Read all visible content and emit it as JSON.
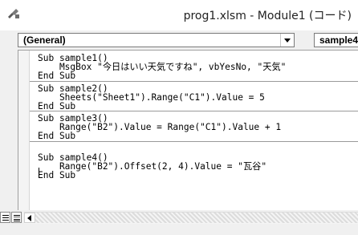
{
  "window": {
    "title": "prog1.xlsm - Module1 (コード)",
    "app_icon": "vba-editor-icon"
  },
  "combos": {
    "object": "(General)",
    "procedure": "sample4"
  },
  "code": {
    "blocks": [
      {
        "lines": [
          [
            "Sub sample1()",
            "sub"
          ],
          [
            "    MsgBox \"今日はいい天気ですね\", vbYesNo, \"天気\"",
            ""
          ],
          [
            "End Sub",
            "end"
          ]
        ]
      },
      {
        "lines": [
          [
            "Sub sample2()",
            "sub"
          ],
          [
            "    Sheets(\"Sheet1\").Range(\"C1\").Value = 5",
            ""
          ],
          [
            "End Sub",
            "end"
          ]
        ]
      },
      {
        "lines": [
          [
            "Sub sample3()",
            "sub"
          ],
          [
            "    Range(\"B2\").Value = Range(\"C1\").Value + 1",
            ""
          ],
          [
            "End Sub",
            "end"
          ]
        ]
      },
      {
        "lines": [
          [
            "",
            ""
          ],
          [
            "Sub sample4()",
            "sub"
          ],
          [
            "    Range(\"B2\").Offset(2, 4).Value = \"瓦谷\"",
            ""
          ],
          [
            "End Sub",
            "end"
          ]
        ]
      }
    ]
  },
  "icons": {
    "procedure_view": "procedure-view-icon",
    "full_module_view": "full-module-view-icon",
    "scroll_left": "scroll-left-arrow-icon"
  }
}
